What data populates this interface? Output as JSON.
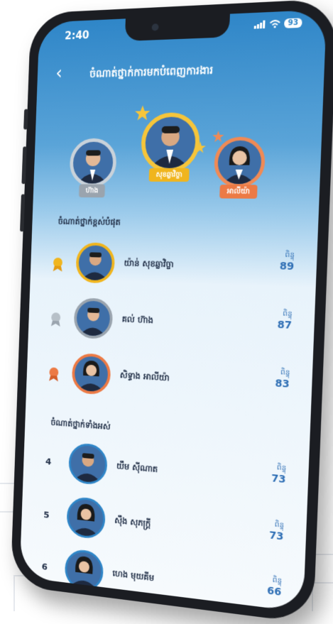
{
  "status": {
    "time": "2:40",
    "battery": "93"
  },
  "header": {
    "back_icon": "chevron-left-icon",
    "title": "ចំណាត់ថ្នាក់ការមកបំពេញការងារ"
  },
  "podium": [
    {
      "place": "2",
      "name": "ហ៊ាង",
      "ribbon_color": "#9aa4ae",
      "ring_color": "#c9d2da"
    },
    {
      "place": "1",
      "name": "សុខឆ្លាវិច្ចា",
      "ribbon_color": "#f0b51e",
      "ring_color": "#f6c53a"
    },
    {
      "place": "3",
      "name": "អាលីយ៉ា",
      "ribbon_color": "#ec7a45",
      "ring_color": "#f08a55"
    }
  ],
  "top_section": {
    "label": "ចំណាត់ថ្នាក់ខ្ពស់បំផុត",
    "rows": [
      {
        "medal": "gold-medal-icon",
        "name": "យ៉ាន់ សុខឆ្លាវិច្ចា",
        "score_label": "ពិន្ទុ",
        "score": "89"
      },
      {
        "medal": "silver-medal-icon",
        "name": "គល់ ហ៊ាង",
        "score_label": "ពិន្ទុ",
        "score": "87"
      },
      {
        "medal": "bronze-medal-icon",
        "name": "សិទ្ធាង អាលីយ៉ា",
        "score_label": "ពិន្ទុ",
        "score": "83"
      }
    ]
  },
  "all_section": {
    "label": "ចំណាត់ថ្នាក់ទាំងអស់",
    "rows": [
      {
        "rank": "4",
        "name": "យឹម ស៊ីណាត",
        "score_label": "ពិន្ទុ",
        "score": "73"
      },
      {
        "rank": "5",
        "name": "ស៊ឹង សុភក្ត្រី",
        "score_label": "ពិន្ទុ",
        "score": "73"
      },
      {
        "rank": "6",
        "name": "ហេង មុយគីម",
        "score_label": "ពិន្ទុ",
        "score": "66"
      }
    ]
  },
  "colors": {
    "primary": "#2f86c8",
    "score": "#2f6fb5",
    "gold": "#f0b51e",
    "silver": "#9aa4ae",
    "bronze": "#ec7a45"
  }
}
